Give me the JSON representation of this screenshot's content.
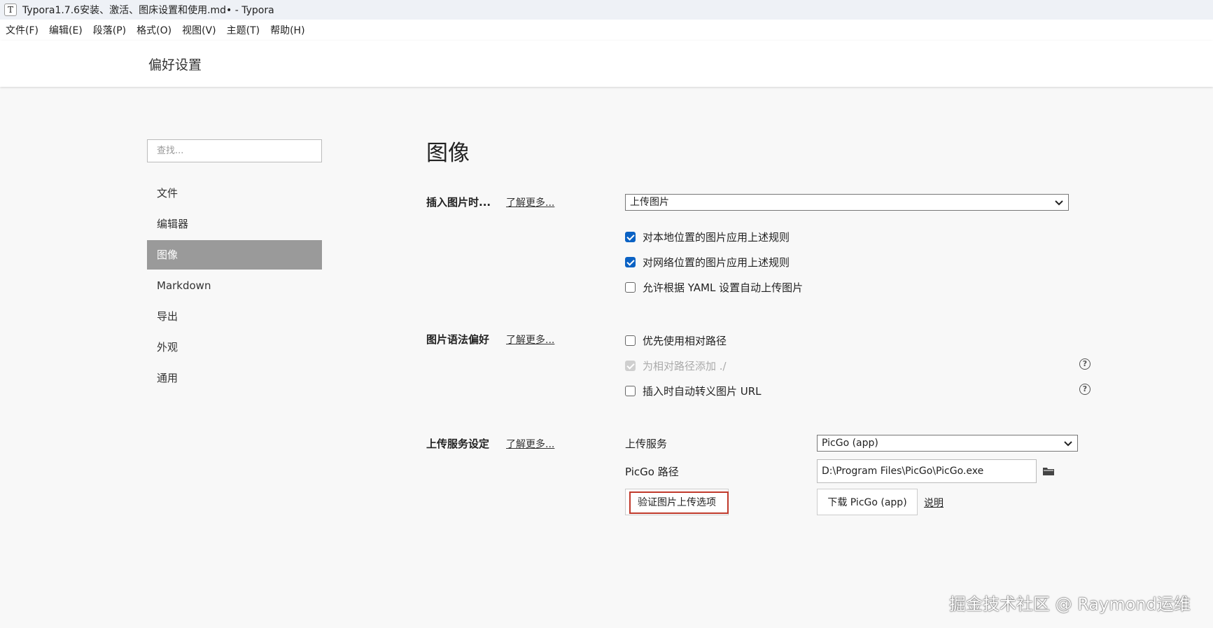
{
  "window": {
    "title": "Typora1.7.6安装、激活、图床设置和使用.md• - Typora",
    "icon_glyph": "T"
  },
  "menu": [
    "文件(F)",
    "编辑(E)",
    "段落(P)",
    "格式(O)",
    "视图(V)",
    "主题(T)",
    "帮助(H)"
  ],
  "header": {
    "title": "偏好设置"
  },
  "search": {
    "placeholder": "查找..."
  },
  "nav": [
    {
      "label": "文件",
      "active": false
    },
    {
      "label": "编辑器",
      "active": false
    },
    {
      "label": "图像",
      "active": true
    },
    {
      "label": "Markdown",
      "active": false
    },
    {
      "label": "导出",
      "active": false
    },
    {
      "label": "外观",
      "active": false
    },
    {
      "label": "通用",
      "active": false
    }
  ],
  "section": {
    "title": "图像",
    "learn_more": "了解更多...",
    "insert": {
      "label": "插入图片时...",
      "select_value": "上传图片",
      "options": [
        {
          "label": "对本地位置的图片应用上述规则",
          "checked": true
        },
        {
          "label": "对网络位置的图片应用上述规则",
          "checked": true
        },
        {
          "label": "允许根据 YAML 设置自动上传图片",
          "checked": false
        }
      ]
    },
    "syntax": {
      "label": "图片语法偏好",
      "options": [
        {
          "label": "优先使用相对路径",
          "checked": false,
          "disabled": false
        },
        {
          "label": "为相对路径添加 ./",
          "checked": true,
          "disabled": true
        },
        {
          "label": "插入时自动转义图片 URL",
          "checked": false,
          "disabled": false
        }
      ]
    },
    "upload": {
      "label": "上传服务设定",
      "service_label": "上传服务",
      "service_value": "PicGo (app)",
      "path_label": "PicGo 路径",
      "path_value": "D:\\Program Files\\PicGo\\PicGo.exe",
      "verify_button": "验证图片上传选项",
      "download_button": "下载 PicGo (app)",
      "explain_link": "说明"
    }
  },
  "watermark": "掘金技术社区 @ Raymond运维",
  "colors": {
    "accent": "#0b62c4",
    "nav_active": "#9a9a9a",
    "highlight": "#c0392b"
  },
  "icons": [
    "chevron-down-icon",
    "checkbox-icon",
    "help-icon",
    "folder-icon"
  ]
}
